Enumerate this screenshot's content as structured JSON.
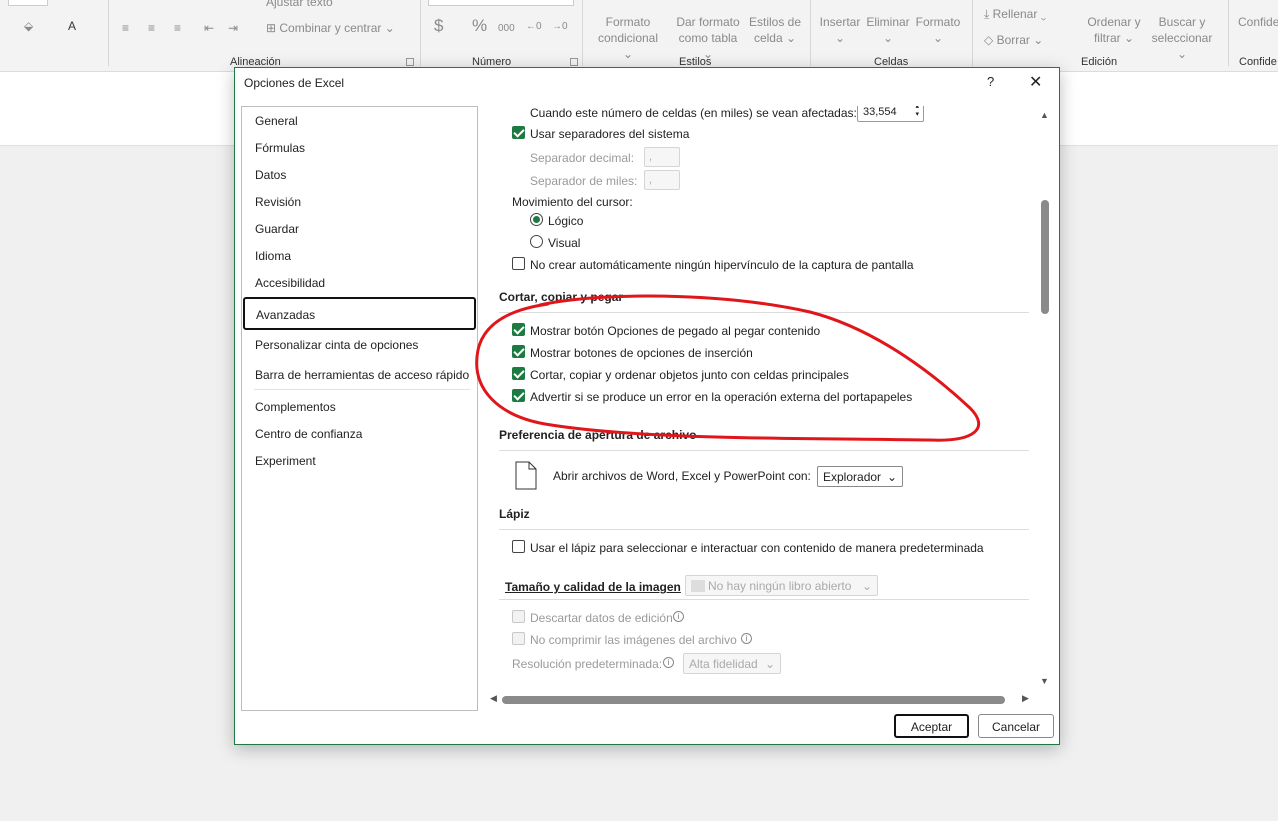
{
  "ribbon": {
    "groups": [
      "Alineación",
      "Número",
      "Estilos",
      "Celdas",
      "Edición",
      "Confide"
    ],
    "items": {
      "ajustar_texto": "Ajustar texto",
      "combinar": "Combinar y centrar",
      "formato_condicional_1": "Formato",
      "formato_condicional_2": "condicional",
      "dar_formato_1": "Dar formato",
      "dar_formato_2": "como tabla",
      "estilos_celda_1": "Estilos de",
      "estilos_celda_2": "celda",
      "insertar": "Insertar",
      "eliminar": "Eliminar",
      "formato": "Formato",
      "rellenar": "Rellenar",
      "borrar": "Borrar",
      "ordenar_1": "Ordenar y",
      "ordenar_2": "filtrar",
      "buscar_1": "Buscar y",
      "buscar_2": "seleccionar",
      "confide": "Confide",
      "currency_symbol": "$",
      "percent_symbol": "%",
      "thousands_symbol": "000",
      "dec_inc": "←0",
      "dec_dec": "→0"
    }
  },
  "dialog": {
    "title": "Opciones de Excel",
    "help": "?",
    "close": "✕"
  },
  "nav": {
    "items": [
      "General",
      "Fórmulas",
      "Datos",
      "Revisión",
      "Guardar",
      "Idioma",
      "Accesibilidad",
      "Avanzadas",
      "Personalizar cinta de opciones",
      "Barra de herramientas de acceso rápido",
      "Complementos",
      "Centro de confianza",
      "Experiment"
    ],
    "selected": "Avanzadas"
  },
  "content": {
    "cells_threshold_label": "Cuando este número de celdas (en miles) se vean afectadas:",
    "cells_threshold_value": "33,554",
    "use_system_separators": "Usar separadores del sistema",
    "decimal_separator": "Separador decimal:",
    "decimal_value": ",",
    "thousands_separator": "Separador de miles:",
    "thousands_value": ",",
    "cursor_movement": "Movimiento del cursor:",
    "logical": "Lógico",
    "visual": "Visual",
    "no_hyperlink": "No crear automáticamente ningún hipervínculo de la captura de pantalla",
    "section_cut_copy": "Cortar, copiar y pegar",
    "show_paste_options": "Mostrar botón Opciones de pegado al pegar contenido",
    "show_insert_options": "Mostrar botones de opciones de inserción",
    "cut_copy_sort": "Cortar, copiar y ordenar objetos junto con celdas principales",
    "warn_clipboard": "Advertir si se produce un error en la operación externa del portapapeles",
    "section_file_open": "Preferencia de apertura de archivo",
    "open_files_label": "Abrir archivos de Word, Excel y PowerPoint con:",
    "open_files_value": "Explorador",
    "section_pen": "Lápiz",
    "use_pen": "Usar el lápiz para seleccionar e interactuar con contenido de manera predeterminada",
    "section_image": "Tamaño y calidad de la imagen",
    "image_workbook": "No hay ningún libro abierto",
    "discard_edit_data": "Descartar datos de edición",
    "no_compress": "No comprimir las imágenes del archivo",
    "default_resolution": "Resolución predeterminada:",
    "resolution_value": "Alta fidelidad",
    "info_glyph": "i"
  },
  "buttons": {
    "ok": "Aceptar",
    "cancel": "Cancelar"
  },
  "colors": {
    "accent": "#1e7a43",
    "annotation": "#e0161b"
  }
}
